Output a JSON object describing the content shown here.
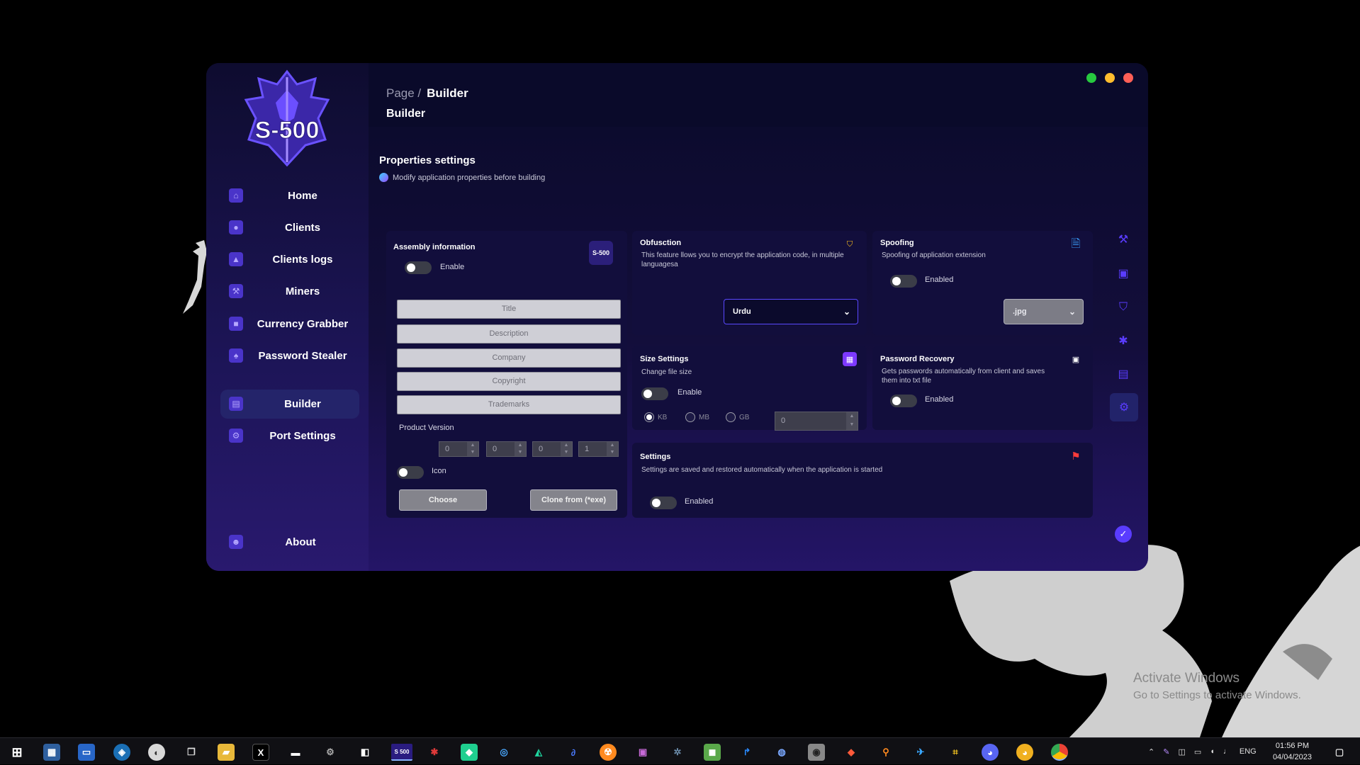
{
  "app": {
    "logo_text": "S-500",
    "window_controls": {
      "minimize_color": "#27c93f",
      "maximize_color": "#ffbd2e",
      "close_color": "#ff5f56"
    }
  },
  "sidebar": {
    "items": [
      {
        "label": "Home",
        "icon": "home-icon"
      },
      {
        "label": "Clients",
        "icon": "users-icon"
      },
      {
        "label": "Clients logs",
        "icon": "user-log-icon"
      },
      {
        "label": "Miners",
        "icon": "miner-icon"
      },
      {
        "label": "Currency Grabber",
        "icon": "wallet-icon"
      },
      {
        "label": "Password Stealer",
        "icon": "key-icon"
      },
      {
        "label": "Builder",
        "icon": "builder-icon",
        "active": true
      },
      {
        "label": "Port Settings",
        "icon": "port-icon"
      }
    ],
    "about": {
      "label": "About",
      "icon": "person-icon"
    }
  },
  "header": {
    "breadcrumb_root": "Page /",
    "breadcrumb_current": "Builder",
    "title": "Builder"
  },
  "section": {
    "title": "Properties settings",
    "subtitle": "Modify application properties before building"
  },
  "assembly": {
    "title": "Assembly information",
    "enable_label": "Enable",
    "fields": [
      "Title",
      "Description",
      "Company",
      "Copyright",
      "Trademarks"
    ],
    "product_version_label": "Product Version",
    "version": [
      "0",
      "0",
      "0",
      "1"
    ],
    "icon_label": "Icon",
    "choose_button": "Choose",
    "clone_button": "Clone from (*exe)",
    "badge_text": "S-500"
  },
  "obfuscation": {
    "title": "Obfusction",
    "description": "This feature llows you to encrypt the application code, in multiple languagesa",
    "selected_language": "Urdu"
  },
  "spoofing": {
    "title": "Spoofing",
    "description": "Spoofing  of application extension",
    "enabled_label": "Enabled",
    "selected_extension": ".jpg"
  },
  "size_settings": {
    "title": "Size Settings",
    "description": "Change file size",
    "enable_label": "Enable",
    "units": [
      "KB",
      "MB",
      "GB"
    ],
    "selected_unit": "KB",
    "size_value": "0"
  },
  "password_recovery": {
    "title": "Password Recovery",
    "description": "Gets passwords automatically from client and saves them into txt file",
    "enabled_label": "Enabled"
  },
  "settings": {
    "title": "Settings",
    "description": "Settings are saved and restored automatically when the application is started",
    "enabled_label": "Enabled"
  },
  "right_bar": {
    "icons": [
      "hammer-icon",
      "archive-icon",
      "shield-icon",
      "bug-icon",
      "toolbox-icon",
      "gear-icon"
    ],
    "confirm_icon": "check-circle-icon"
  },
  "watermark": {
    "line1": "Activate Windows",
    "line2": "Go to Settings to activate Windows."
  },
  "taskbar": {
    "running_app_label": "S 500",
    "language": "ENG",
    "time": "01:56 PM",
    "date": "04/04/2023"
  },
  "colors": {
    "accent": "#4a34c9",
    "card_bg": "#120e3c",
    "active_nav": "#24246a"
  }
}
